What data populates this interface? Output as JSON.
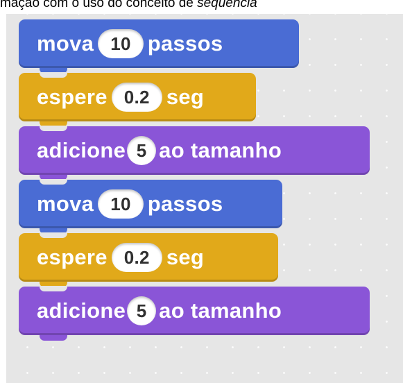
{
  "caption": {
    "text": "mação com o uso do conceito de ",
    "italic": "sequência"
  },
  "blocks": [
    {
      "category": "motion",
      "pre": "mova",
      "value": "10",
      "post": "passos"
    },
    {
      "category": "control",
      "pre": "espere",
      "value": "0.2",
      "post": "seg"
    },
    {
      "category": "looks",
      "pre": "adicione",
      "value": "5",
      "post": "ao tamanho"
    },
    {
      "category": "motion",
      "pre": "mova",
      "value": "10",
      "post": "passos"
    },
    {
      "category": "control",
      "pre": "espere",
      "value": "0.2",
      "post": "seg"
    },
    {
      "category": "looks",
      "pre": "adicione",
      "value": "5",
      "post": "ao tamanho"
    }
  ],
  "colors": {
    "motion": "#4a6cd4",
    "control": "#e1a91a",
    "looks": "#8a55d7",
    "canvas": "#e6e6e6"
  }
}
